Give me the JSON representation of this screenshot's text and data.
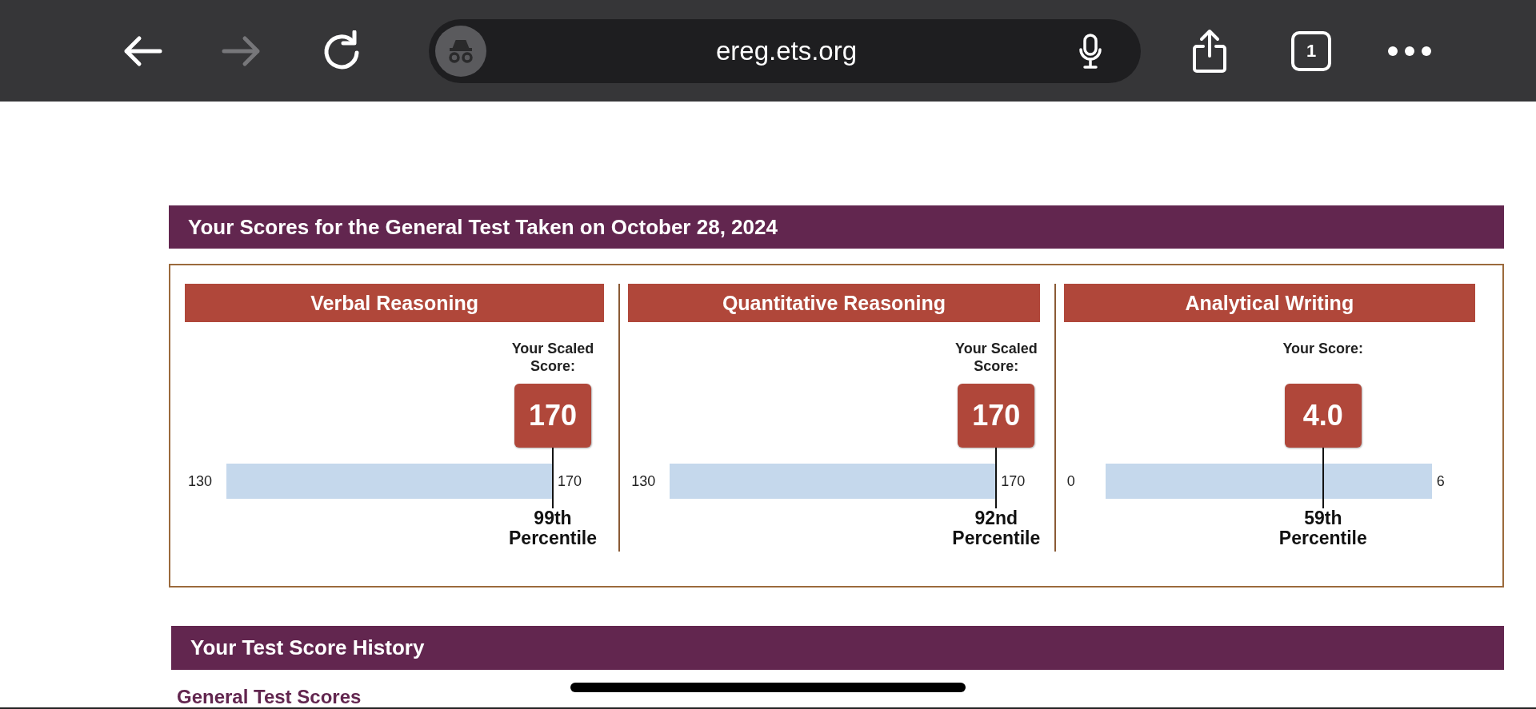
{
  "browser": {
    "url": "ereg.ets.org",
    "forward_enabled": false,
    "tab_count": "1"
  },
  "scores": {
    "title": "Your Scores for the General Test Taken on October 28, 2024",
    "sections": [
      {
        "name": "Verbal Reasoning",
        "caption": "Your Scaled Score:",
        "score": "170",
        "scale_min": "130",
        "scale_max": "170",
        "level": 1,
        "percentile": "99th",
        "percentile_label": "Percentile"
      },
      {
        "name": "Quantitative Reasoning",
        "caption": "Your Scaled Score:",
        "score": "170",
        "scale_min": "130",
        "scale_max": "170",
        "level": 1,
        "percentile": "92nd",
        "percentile_label": "Percentile"
      },
      {
        "name": "Analytical Writing",
        "caption": "Your Score:",
        "score": "4.0",
        "scale_min": "0",
        "scale_max": "6",
        "level": 0.667,
        "percentile": "59th",
        "percentile_label": "Percentile"
      }
    ]
  },
  "history": {
    "title": "Your Test Score History",
    "subtitle": "General Test Scores"
  }
}
